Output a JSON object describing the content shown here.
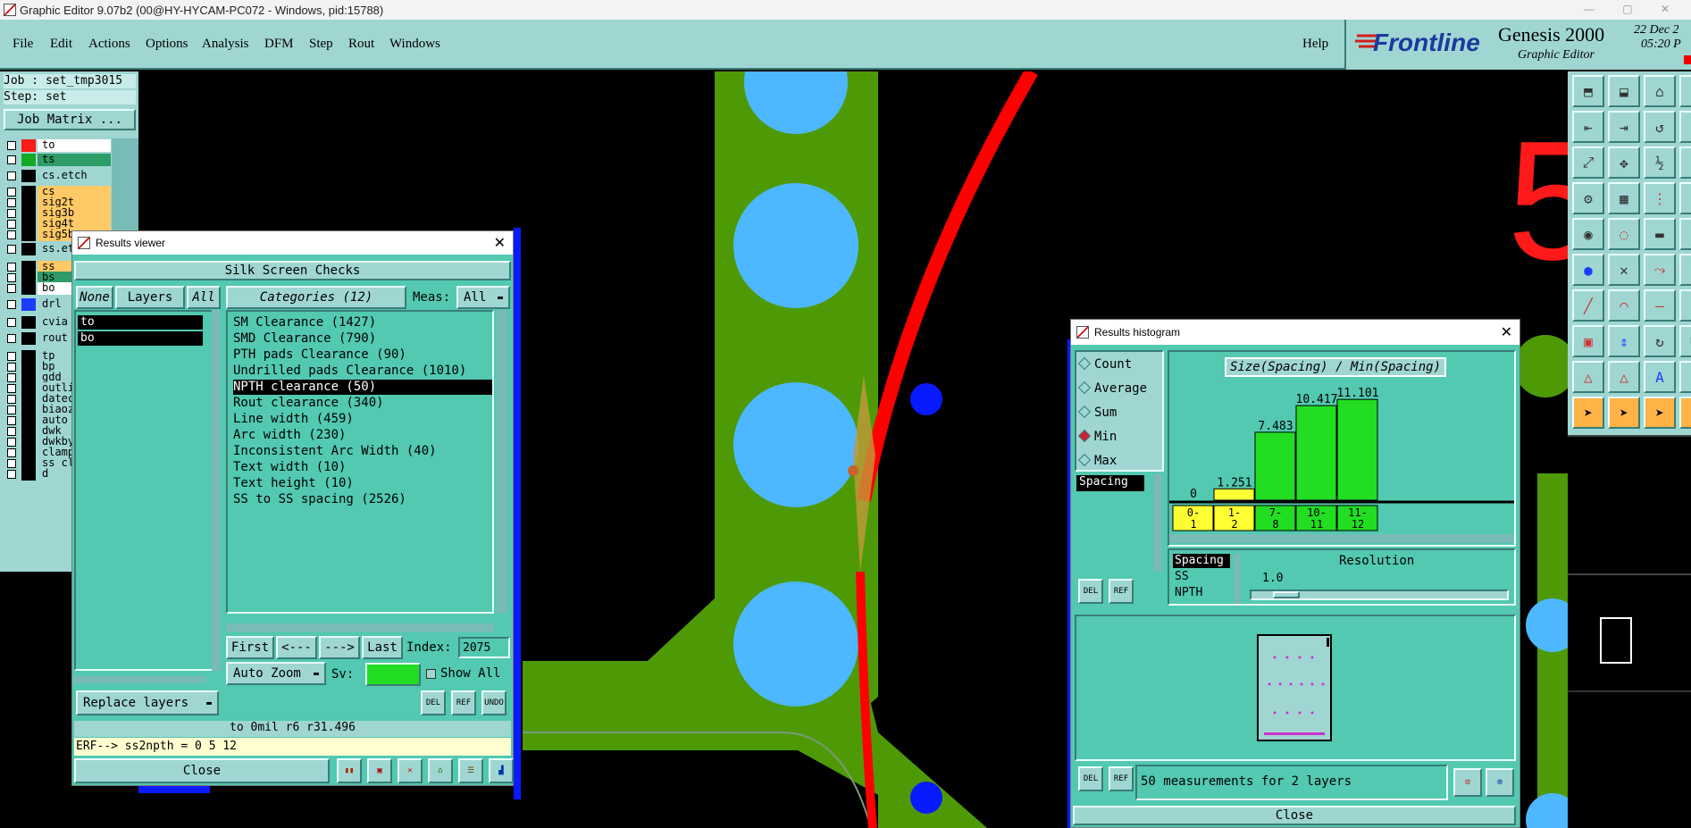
{
  "window": {
    "title": "Graphic Editor 9.07b2 (00@HY-HYCAM-PC072 - Windows, pid:15788)"
  },
  "menu": [
    "File",
    "Edit",
    "Actions",
    "Options",
    "Analysis",
    "DFM",
    "Step",
    "Rout",
    "Windows"
  ],
  "help": "Help",
  "brand": {
    "logo": "Frontline",
    "product": "Genesis 2000",
    "subtitle": "Graphic Editor",
    "date": "22 Dec 2",
    "time": "05:20 P"
  },
  "job": {
    "job_line": "Job : set_tmp3015",
    "step_line": "Step: set",
    "matrix_button": "Job Matrix ..."
  },
  "layers": [
    {
      "name": "to",
      "swatch": "#ff1a1a",
      "bg": "#ffffff"
    },
    {
      "name": "ts",
      "swatch": "#11aa22",
      "bg": "#2e9c66"
    },
    {
      "name": "cs.etch",
      "swatch": "#000000",
      "bg": "#9fd6d2"
    },
    {
      "name": "cs",
      "swatch": "#000000",
      "bg": "#ffc966"
    },
    {
      "name": "sig2t",
      "swatch": "#000000",
      "bg": "#ffc966"
    },
    {
      "name": "sig3b",
      "swatch": "#000000",
      "bg": "#ffc966"
    },
    {
      "name": "sig4t",
      "swatch": "#000000",
      "bg": "#ffc966"
    },
    {
      "name": "sig5b",
      "swatch": "#000000",
      "bg": "#ffc966"
    },
    {
      "name": "ss.etch",
      "swatch": "#000000",
      "bg": "#9fd6d2"
    },
    {
      "name": "ss",
      "swatch": "#000000",
      "bg": "#ffc966"
    },
    {
      "name": "bs",
      "swatch": "#000000",
      "bg": "#2e9c66"
    },
    {
      "name": "bo",
      "swatch": "#000000",
      "bg": "#ffffff"
    },
    {
      "name": "drl",
      "swatch": "#1a3cff",
      "bg": "#9fd6d2"
    },
    {
      "name": "cvia",
      "swatch": "#000000",
      "bg": "#9fd6d2"
    },
    {
      "name": "rout",
      "swatch": "#000000",
      "bg": "#9fd6d2"
    },
    {
      "name": "tp",
      "swatch": "#000000",
      "bg": "#9fd6d2"
    },
    {
      "name": "bp",
      "swatch": "#000000",
      "bg": "#9fd6d2"
    },
    {
      "name": "gdd",
      "swatch": "#000000",
      "bg": "#9fd6d2"
    },
    {
      "name": "outline",
      "swatch": "#000000",
      "bg": "#9fd6d2"
    },
    {
      "name": "datecode",
      "swatch": "#000000",
      "bg": "#9fd6d2"
    },
    {
      "name": "biaozhi",
      "swatch": "#000000",
      "bg": "#9fd6d2"
    },
    {
      "name": "auto_c",
      "swatch": "#000000",
      "bg": "#9fd6d2"
    },
    {
      "name": "dwk",
      "swatch": "#000000",
      "bg": "#9fd6d2"
    },
    {
      "name": "dwkby",
      "swatch": "#000000",
      "bg": "#9fd6d2"
    },
    {
      "name": "clamp",
      "swatch": "#000000",
      "bg": "#9fd6d2"
    },
    {
      "name": "ss_clr",
      "swatch": "#000000",
      "bg": "#9fd6d2"
    },
    {
      "name": "d",
      "swatch": "#000000",
      "bg": "#9fd6d2"
    }
  ],
  "results_viewer": {
    "title": "Results viewer",
    "section": "Silk Screen Checks",
    "none_btn": "None",
    "layers_btn": "Layers",
    "all_btn": "All",
    "categories_btn": "Categories (12)",
    "meas_label": "Meas:",
    "meas_value": "All",
    "layer_items": [
      "to",
      "bo"
    ],
    "categories": [
      "SM Clearance (1427)",
      "SMD Clearance (790)",
      "PTH pads Clearance (90)",
      "Undrilled pads Clearance (1010)",
      "NPTH clearance (50)",
      "Rout clearance (340)",
      "Line width (459)",
      "Arc width (230)",
      "Inconsistent Arc Width (40)",
      "Text width (10)",
      "Text height (10)",
      "SS to SS spacing (2526)"
    ],
    "nav": {
      "first": "First",
      "prev": "<---",
      "next": "--->",
      "last": "Last",
      "index_label": "Index:",
      "index_value": "2075"
    },
    "zoom": "Auto Zoom",
    "sv_label": "Sv:",
    "show_all": "Show All",
    "replace_layers": "Replace layers",
    "status": "to 0mil  r6  r31.496",
    "erf": "ERF--> ss2npth = 0 5 12",
    "close": "Close",
    "del": "DEL",
    "ref": "REF",
    "undo": "UNDO"
  },
  "histogram": {
    "title": "Results histogram",
    "modes": [
      "Count",
      "Average",
      "Sum",
      "Min",
      "Max"
    ],
    "selected_mode": "Min",
    "spacing_tag": "Spacing",
    "chart_title": "Size(Spacing) / Min(Spacing)",
    "resolution_label": "Resolution",
    "resolution_value": "1.0",
    "legend_items": [
      "Spacing",
      "SS",
      "NPTH"
    ],
    "footer": "50 measurements for 2 layers",
    "close": "Close",
    "del": "DEL",
    "ref": "REF"
  },
  "chart_data": {
    "type": "bar",
    "title": "Size(Spacing) / Min(Spacing)",
    "categories": [
      "0-1",
      "1-2",
      "7-8",
      "10-11",
      "11-12"
    ],
    "values": [
      0,
      1.251,
      7.483,
      10.417,
      11.101
    ],
    "bar_colors": [
      "#ffff33",
      "#ffff33",
      "#22dd22",
      "#22dd22",
      "#22dd22"
    ],
    "ylim": [
      0,
      12
    ]
  },
  "canvas": {
    "label": "5"
  }
}
